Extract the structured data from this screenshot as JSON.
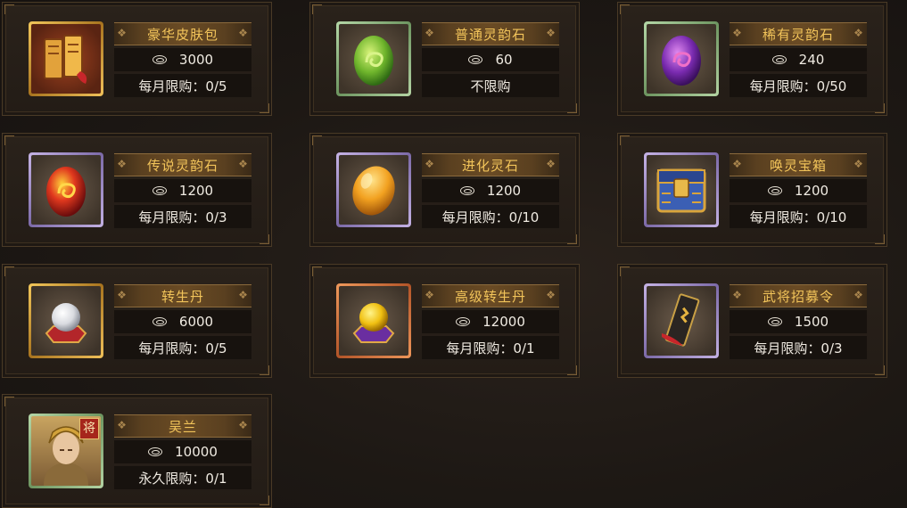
{
  "shop": {
    "items": [
      {
        "name": "豪华皮肤包",
        "price": "3000",
        "limit": "每月限购：0/5",
        "icon": "skin-pack-icon",
        "frame": "#f3c85b"
      },
      {
        "name": "普通灵韵石",
        "price": "60",
        "limit": "不限购",
        "icon": "green-spirit-stone-icon",
        "frame": "#b5d8a8"
      },
      {
        "name": "稀有灵韵石",
        "price": "240",
        "limit": "每月限购：0/50",
        "icon": "purple-spirit-stone-icon",
        "frame": "#b5d8a8"
      },
      {
        "name": "传说灵韵石",
        "price": "1200",
        "limit": "每月限购：0/3",
        "icon": "red-spirit-stone-icon",
        "frame": "#c6b4e6"
      },
      {
        "name": "进化灵石",
        "price": "1200",
        "limit": "每月限购：0/10",
        "icon": "evolution-stone-icon",
        "frame": "#c6b4e6"
      },
      {
        "name": "唤灵宝箱",
        "price": "1200",
        "limit": "每月限购：0/10",
        "icon": "summon-chest-icon",
        "frame": "#c6b4e6"
      },
      {
        "name": "转生丹",
        "price": "6000",
        "limit": "每月限购：0/5",
        "icon": "white-pearl-icon",
        "frame": "#f3c85b"
      },
      {
        "name": "高级转生丹",
        "price": "12000",
        "limit": "每月限购：0/1",
        "icon": "gold-pearl-icon",
        "frame": "#f09a5c"
      },
      {
        "name": "武将招募令",
        "price": "1500",
        "limit": "每月限购：0/3",
        "icon": "recruit-token-icon",
        "frame": "#c6b4e6"
      },
      {
        "name": "吴兰",
        "price": "10000",
        "limit": "永久限购：0/1",
        "icon": "general-portrait-icon",
        "frame": "#b5d8a8",
        "badge": "将"
      }
    ]
  },
  "colors": {
    "title_text": "#f2c45a",
    "value_text": "#f0ebe2",
    "background": "#1b1612"
  }
}
